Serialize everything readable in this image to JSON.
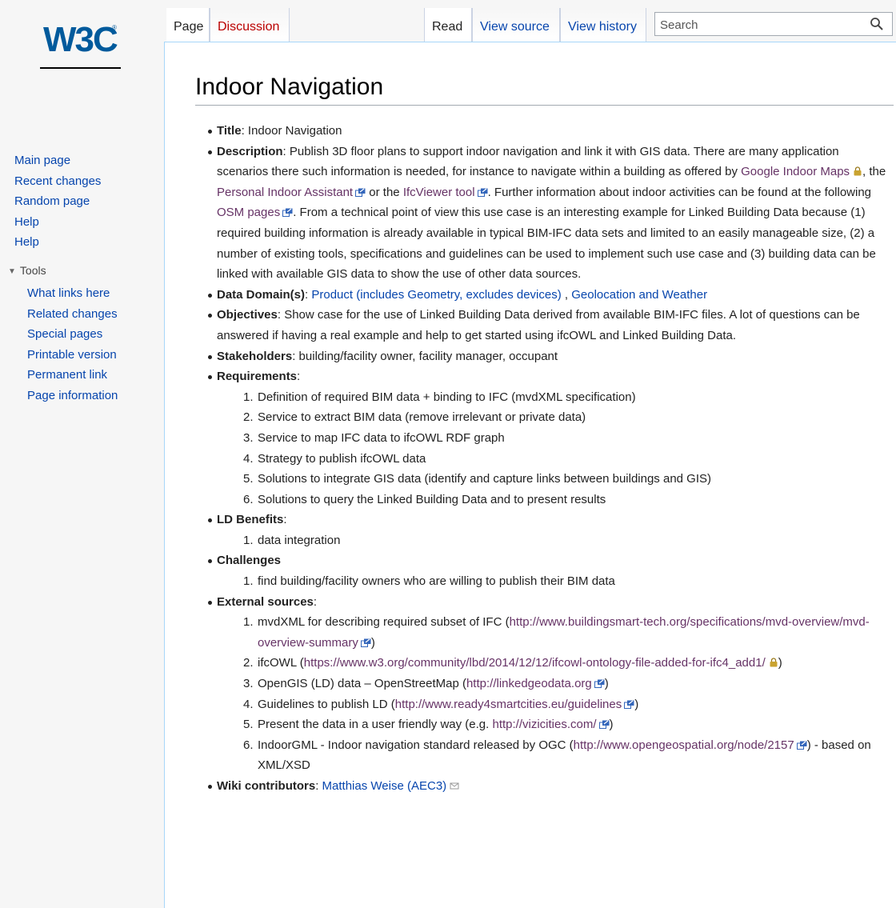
{
  "logo": {
    "text": "W3C",
    "reg": "®"
  },
  "sidebar": {
    "nav": [
      "Main page",
      "Recent changes",
      "Random page",
      "Help",
      "Help"
    ],
    "tools_label": "Tools",
    "tools": [
      "What links here",
      "Related changes",
      "Special pages",
      "Printable version",
      "Permanent link",
      "Page information"
    ]
  },
  "tabs": {
    "page": "Page",
    "discussion": "Discussion",
    "read": "Read",
    "view_source": "View source",
    "view_history": "View history"
  },
  "search": {
    "placeholder": "Search"
  },
  "page": {
    "title": "Indoor Navigation",
    "title_label": "Title",
    "title_value": ": Indoor Navigation",
    "description_label": "Description",
    "description_1": ": Publish 3D floor plans to support indoor navigation and link it with GIS data. There are many application scenarios there such information is needed, for instance to navigate within a building as offered by ",
    "link_google": "Google Indoor Maps",
    "description_2": ", the ",
    "link_pia": "Personal Indoor Assistant",
    "description_3": " or the ",
    "link_ifcviewer": "IfcViewer tool",
    "description_4": ". Further information about indoor activities can be found at the following ",
    "link_osm": "OSM pages",
    "description_5": ". From a technical point of view this use case is an interesting example for Linked Building Data because (1) required building information is already available in typical BIM-IFC data sets and limited to an easily manageable size, (2) a number of existing tools, specifications and guidelines can be used to implement such use case and (3) building data can be linked with available GIS data to show the use of other data sources.",
    "domain_label": "Data Domain(s)",
    "domain_sep": ": ",
    "domain_link1": "Product (includes Geometry, excludes devices)",
    "domain_sep2": " , ",
    "domain_link2": "Geolocation and Weather",
    "objectives_label": "Objectives",
    "objectives_text": ": Show case for the use of Linked Building Data derived from available BIM-IFC files. A lot of questions can be answered if having a real example and help to get started using ifcOWL and Linked Building Data.",
    "stakeholders_label": "Stakeholders",
    "stakeholders_text": ": building/facility owner, facility manager, occupant",
    "requirements_label": "Requirements",
    "requirements_colon": ":",
    "requirements": [
      "Definition of required BIM data + binding to IFC (mvdXML specification)",
      "Service to extract BIM data (remove irrelevant or private data)",
      "Service to map IFC data to ifcOWL RDF graph",
      "Strategy to publish ifcOWL data",
      "Solutions to integrate GIS data (identify and capture links between buildings and GIS)",
      "Solutions to query the Linked Building Data and to present results"
    ],
    "benefits_label": "LD Benefits",
    "benefits_colon": ":",
    "benefits": [
      "data integration"
    ],
    "challenges_label": "Challenges",
    "challenges": [
      "find building/facility owners who are willing to publish their BIM data"
    ],
    "sources_label": "External sources",
    "sources_colon": ":",
    "sources": [
      {
        "pre": "mvdXML for describing required subset of IFC (",
        "link": "http://www.buildingsmart-tech.org/specifications/mvd-overview/mvd-overview-summary",
        "post": ")"
      },
      {
        "pre": "ifcOWL (",
        "link": "https://www.w3.org/community/lbd/2014/12/12/ifcowl-ontology-file-added-for-ifc4_add1/",
        "post": ")"
      },
      {
        "pre": "OpenGIS (LD) data – OpenStreetMap (",
        "link": "http://linkedgeodata.org",
        "post": ")"
      },
      {
        "pre": "Guidelines to publish LD (",
        "link": "http://www.ready4smartcities.eu/guidelines",
        "post": ")"
      },
      {
        "pre": "Present the data in a user friendly way (e.g. ",
        "link": "http://vizicities.com/",
        "post": ")"
      },
      {
        "pre": "IndoorGML - Indoor navigation standard released by OGC (",
        "link": "http://www.opengeospatial.org/node/2157",
        "post": ") - based on XML/XSD"
      }
    ],
    "contributors_label": "Wiki contributors",
    "contributors_sep": ": ",
    "contributors_link": "Matthias Weise (AEC3)"
  },
  "colors": {
    "link": "#0645ad",
    "visited_link": "#663366",
    "new_link": "#ba0000",
    "logo_blue": "#005a9c"
  }
}
